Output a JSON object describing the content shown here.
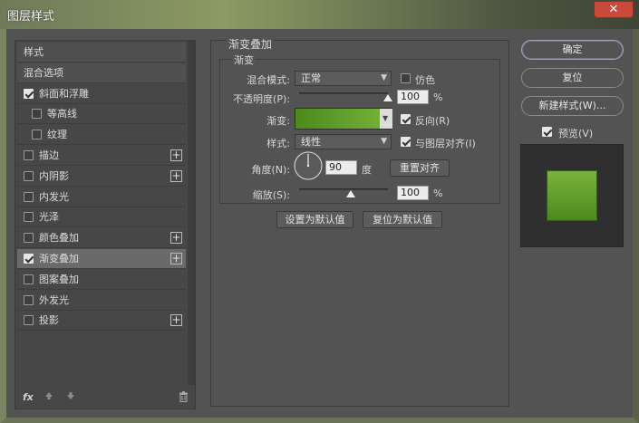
{
  "window": {
    "title": "图层样式",
    "close_glyph": "✕"
  },
  "left_panel": {
    "items": [
      {
        "label": "样式",
        "checkbox": false,
        "checked": false,
        "plus": false,
        "header": true
      },
      {
        "label": "混合选项",
        "checkbox": false,
        "checked": false,
        "plus": false,
        "header": true
      },
      {
        "label": "斜面和浮雕",
        "checkbox": true,
        "checked": true,
        "plus": false
      },
      {
        "label": "等高线",
        "checkbox": true,
        "checked": false,
        "plus": false,
        "indent": true
      },
      {
        "label": "纹理",
        "checkbox": true,
        "checked": false,
        "plus": false,
        "indent": true
      },
      {
        "label": "描边",
        "checkbox": true,
        "checked": false,
        "plus": true
      },
      {
        "label": "内阴影",
        "checkbox": true,
        "checked": false,
        "plus": true
      },
      {
        "label": "内发光",
        "checkbox": true,
        "checked": false,
        "plus": false
      },
      {
        "label": "光泽",
        "checkbox": true,
        "checked": false,
        "plus": false
      },
      {
        "label": "颜色叠加",
        "checkbox": true,
        "checked": false,
        "plus": true
      },
      {
        "label": "渐变叠加",
        "checkbox": true,
        "checked": true,
        "plus": true,
        "selected": true
      },
      {
        "label": "图案叠加",
        "checkbox": true,
        "checked": false,
        "plus": false
      },
      {
        "label": "外发光",
        "checkbox": true,
        "checked": false,
        "plus": false
      },
      {
        "label": "投影",
        "checkbox": true,
        "checked": false,
        "plus": true
      }
    ],
    "fx_label": "fx",
    "icons": [
      "fx-icon",
      "move-up-icon",
      "move-down-icon",
      "trash-icon"
    ]
  },
  "main": {
    "group_title": "渐变叠加",
    "sub_title": "渐变",
    "blend_mode": {
      "label": "混合模式:",
      "value": "正常"
    },
    "dither": {
      "label": "仿色",
      "checked": false
    },
    "opacity": {
      "label": "不透明度(P):",
      "value": "100",
      "unit": "%",
      "level": 100
    },
    "gradient": {
      "label": "渐变:",
      "color_start": "#4c8a1e",
      "color_end": "#79b33a"
    },
    "reverse": {
      "label": "反向(R)",
      "checked": true
    },
    "style": {
      "label": "样式:",
      "value": "线性"
    },
    "align_layer": {
      "label": "与图层对齐(I)",
      "checked": true
    },
    "angle": {
      "label": "角度(N):",
      "value": "90",
      "unit": "度",
      "degrees": 90
    },
    "reset_align_button": "重置对齐",
    "scale": {
      "label": "缩放(S):",
      "value": "100",
      "unit": "%",
      "level": 100
    },
    "set_default_button": "设置为默认值",
    "reset_default_button": "复位为默认值"
  },
  "right_panel": {
    "ok_button": "确定",
    "reset_button": "复位",
    "new_style_button": "新建样式(W)...",
    "preview": {
      "label": "预览(V)",
      "checked": true
    }
  },
  "colors": {
    "accent_green": "#6aa82e",
    "close_red": "#c94a3b"
  }
}
